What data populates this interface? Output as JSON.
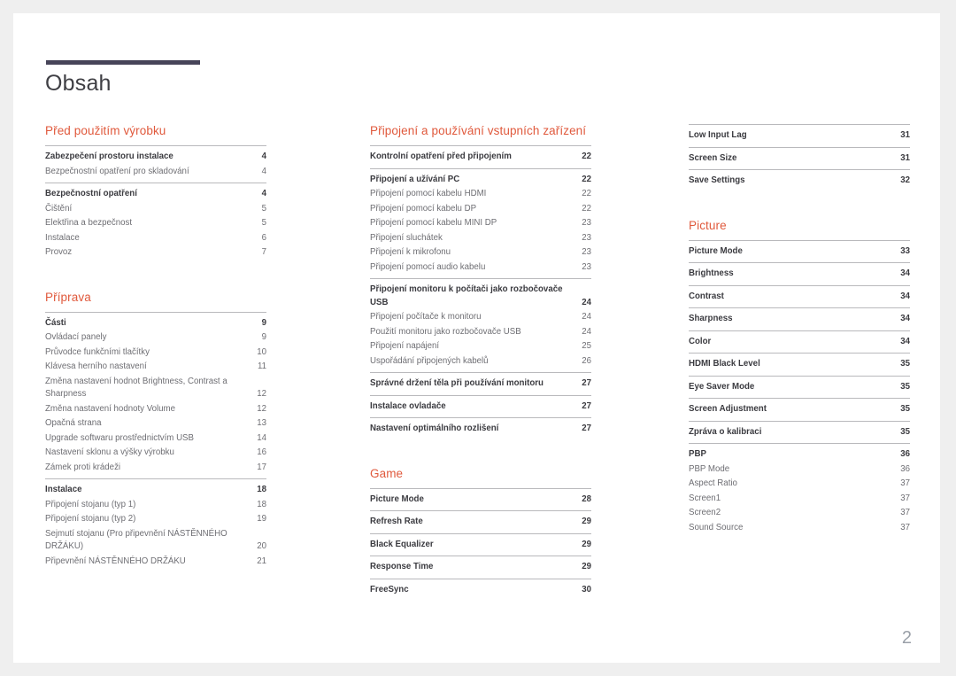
{
  "document": {
    "title": "Obsah",
    "page_number": "2",
    "accent_color": "#e0593c",
    "rule_color": "#474459"
  },
  "columns": [
    {
      "name": "column-1",
      "sections": [
        {
          "heading": "Před použitím výrobku",
          "groups": [
            {
              "entries": [
                {
                  "label": "Zabezpečení prostoru instalace",
                  "page": "4",
                  "lead": true
                },
                {
                  "label": "Bezpečnostní opatření pro skladování",
                  "page": "4",
                  "lead": false
                }
              ]
            },
            {
              "entries": [
                {
                  "label": "Bezpečnostní opatření",
                  "page": "4",
                  "lead": true
                },
                {
                  "label": "Čištění",
                  "page": "5",
                  "lead": false
                },
                {
                  "label": "Elektřina a bezpečnost",
                  "page": "5",
                  "lead": false
                },
                {
                  "label": "Instalace",
                  "page": "6",
                  "lead": false
                },
                {
                  "label": "Provoz",
                  "page": "7",
                  "lead": false
                }
              ]
            }
          ]
        },
        {
          "heading": "Příprava",
          "groups": [
            {
              "entries": [
                {
                  "label": "Části",
                  "page": "9",
                  "lead": true
                },
                {
                  "label": "Ovládací panely",
                  "page": "9",
                  "lead": false
                },
                {
                  "label": "Průvodce funkčními tlačítky",
                  "page": "10",
                  "lead": false
                },
                {
                  "label": "Klávesa herního nastavení",
                  "page": "11",
                  "lead": false
                },
                {
                  "label": "Změna nastavení hodnot Brightness, Contrast a Sharpness",
                  "page": "12",
                  "lead": false
                },
                {
                  "label": "Změna nastavení hodnoty Volume",
                  "page": "12",
                  "lead": false
                },
                {
                  "label": "Opačná strana",
                  "page": "13",
                  "lead": false
                },
                {
                  "label": "Upgrade softwaru prostřednictvím USB",
                  "page": "14",
                  "lead": false
                },
                {
                  "label": "Nastavení sklonu a výšky výrobku",
                  "page": "16",
                  "lead": false
                },
                {
                  "label": "Zámek proti krádeži",
                  "page": "17",
                  "lead": false
                }
              ]
            },
            {
              "entries": [
                {
                  "label": "Instalace",
                  "page": "18",
                  "lead": true
                },
                {
                  "label": "Připojení stojanu (typ 1)",
                  "page": "18",
                  "lead": false
                },
                {
                  "label": "Připojení stojanu (typ 2)",
                  "page": "19",
                  "lead": false
                },
                {
                  "label": "Sejmutí stojanu (Pro připevnění NÁSTĚNNÉHO DRŽÁKU)",
                  "page": "20",
                  "lead": false
                },
                {
                  "label": "Připevnění NÁSTĚNNÉHO DRŽÁKU",
                  "page": "21",
                  "lead": false
                }
              ]
            }
          ]
        }
      ]
    },
    {
      "name": "column-2",
      "sections": [
        {
          "heading": "Připojení a používání vstupních zařízení",
          "groups": [
            {
              "entries": [
                {
                  "label": "Kontrolní opatření před připojením",
                  "page": "22",
                  "lead": true
                }
              ]
            },
            {
              "entries": [
                {
                  "label": "Připojení a užívání PC",
                  "page": "22",
                  "lead": true
                },
                {
                  "label": "Připojení pomocí kabelu HDMI",
                  "page": "22",
                  "lead": false
                },
                {
                  "label": "Připojení pomocí kabelu DP",
                  "page": "22",
                  "lead": false
                },
                {
                  "label": "Připojení pomocí kabelu MINI DP",
                  "page": "23",
                  "lead": false
                },
                {
                  "label": "Připojení sluchátek",
                  "page": "23",
                  "lead": false
                },
                {
                  "label": "Připojení k mikrofonu",
                  "page": "23",
                  "lead": false
                },
                {
                  "label": "Připojení pomocí audio kabelu",
                  "page": "23",
                  "lead": false
                }
              ]
            },
            {
              "entries": [
                {
                  "label": "Připojení monitoru k počítači jako rozbočovače USB",
                  "page": "24",
                  "lead": true
                },
                {
                  "label": "Připojení počítače k monitoru",
                  "page": "24",
                  "lead": false
                },
                {
                  "label": "Použití monitoru jako rozbočovače USB",
                  "page": "24",
                  "lead": false
                },
                {
                  "label": "Připojení napájení",
                  "page": "25",
                  "lead": false
                },
                {
                  "label": "Uspořádání připojených kabelů",
                  "page": "26",
                  "lead": false
                }
              ]
            },
            {
              "entries": [
                {
                  "label": "Správné držení těla při používání monitoru",
                  "page": "27",
                  "lead": true
                }
              ]
            },
            {
              "entries": [
                {
                  "label": "Instalace ovladače",
                  "page": "27",
                  "lead": true
                }
              ]
            },
            {
              "entries": [
                {
                  "label": "Nastavení optimálního rozlišení",
                  "page": "27",
                  "lead": true
                }
              ]
            }
          ]
        },
        {
          "heading": "Game",
          "groups": [
            {
              "entries": [
                {
                  "label": "Picture Mode",
                  "page": "28",
                  "lead": true
                }
              ]
            },
            {
              "entries": [
                {
                  "label": "Refresh Rate",
                  "page": "29",
                  "lead": true
                }
              ]
            },
            {
              "entries": [
                {
                  "label": "Black Equalizer",
                  "page": "29",
                  "lead": true
                }
              ]
            },
            {
              "entries": [
                {
                  "label": "Response Time",
                  "page": "29",
                  "lead": true
                }
              ]
            },
            {
              "entries": [
                {
                  "label": "FreeSync",
                  "page": "30",
                  "lead": true
                }
              ]
            }
          ]
        }
      ]
    },
    {
      "name": "column-3",
      "sections": [
        {
          "heading": "",
          "groups": [
            {
              "entries": [
                {
                  "label": "Low Input Lag",
                  "page": "31",
                  "lead": true
                }
              ]
            },
            {
              "entries": [
                {
                  "label": "Screen Size",
                  "page": "31",
                  "lead": true
                }
              ]
            },
            {
              "entries": [
                {
                  "label": "Save Settings",
                  "page": "32",
                  "lead": true
                }
              ]
            }
          ]
        },
        {
          "heading": "Picture",
          "groups": [
            {
              "entries": [
                {
                  "label": "Picture Mode",
                  "page": "33",
                  "lead": true
                }
              ]
            },
            {
              "entries": [
                {
                  "label": "Brightness",
                  "page": "34",
                  "lead": true
                }
              ]
            },
            {
              "entries": [
                {
                  "label": "Contrast",
                  "page": "34",
                  "lead": true
                }
              ]
            },
            {
              "entries": [
                {
                  "label": "Sharpness",
                  "page": "34",
                  "lead": true
                }
              ]
            },
            {
              "entries": [
                {
                  "label": "Color",
                  "page": "34",
                  "lead": true
                }
              ]
            },
            {
              "entries": [
                {
                  "label": "HDMI Black Level",
                  "page": "35",
                  "lead": true
                }
              ]
            },
            {
              "entries": [
                {
                  "label": "Eye Saver Mode",
                  "page": "35",
                  "lead": true
                }
              ]
            },
            {
              "entries": [
                {
                  "label": "Screen Adjustment",
                  "page": "35",
                  "lead": true
                }
              ]
            },
            {
              "entries": [
                {
                  "label": "Zpráva o kalibraci",
                  "page": "35",
                  "lead": true
                }
              ]
            },
            {
              "entries": [
                {
                  "label": "PBP",
                  "page": "36",
                  "lead": true
                },
                {
                  "label": "PBP Mode",
                  "page": "36",
                  "lead": false
                },
                {
                  "label": "Aspect Ratio",
                  "page": "37",
                  "lead": false
                },
                {
                  "label": "Screen1",
                  "page": "37",
                  "lead": false
                },
                {
                  "label": "Screen2",
                  "page": "37",
                  "lead": false
                },
                {
                  "label": "Sound Source",
                  "page": "37",
                  "lead": false
                }
              ]
            }
          ]
        }
      ]
    }
  ]
}
